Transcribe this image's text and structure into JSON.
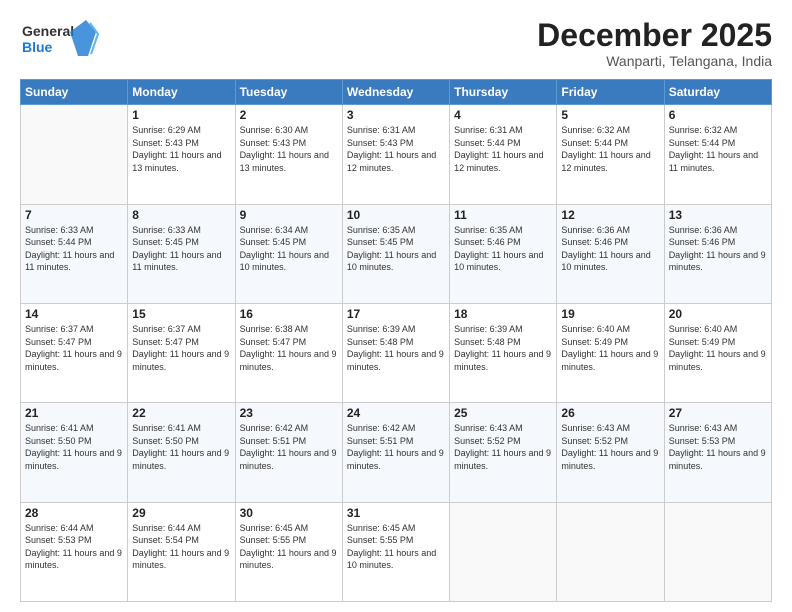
{
  "header": {
    "logo": {
      "general": "General",
      "blue": "Blue"
    },
    "title": "December 2025",
    "location": "Wanparti, Telangana, India"
  },
  "weekdays": [
    "Sunday",
    "Monday",
    "Tuesday",
    "Wednesday",
    "Thursday",
    "Friday",
    "Saturday"
  ],
  "weeks": [
    [
      {
        "day": null
      },
      {
        "day": 1,
        "sunrise": "6:29 AM",
        "sunset": "5:43 PM",
        "daylight": "11 hours and 13 minutes."
      },
      {
        "day": 2,
        "sunrise": "6:30 AM",
        "sunset": "5:43 PM",
        "daylight": "11 hours and 13 minutes."
      },
      {
        "day": 3,
        "sunrise": "6:31 AM",
        "sunset": "5:43 PM",
        "daylight": "11 hours and 12 minutes."
      },
      {
        "day": 4,
        "sunrise": "6:31 AM",
        "sunset": "5:44 PM",
        "daylight": "11 hours and 12 minutes."
      },
      {
        "day": 5,
        "sunrise": "6:32 AM",
        "sunset": "5:44 PM",
        "daylight": "11 hours and 12 minutes."
      },
      {
        "day": 6,
        "sunrise": "6:32 AM",
        "sunset": "5:44 PM",
        "daylight": "11 hours and 11 minutes."
      }
    ],
    [
      {
        "day": 7,
        "sunrise": "6:33 AM",
        "sunset": "5:44 PM",
        "daylight": "11 hours and 11 minutes."
      },
      {
        "day": 8,
        "sunrise": "6:33 AM",
        "sunset": "5:45 PM",
        "daylight": "11 hours and 11 minutes."
      },
      {
        "day": 9,
        "sunrise": "6:34 AM",
        "sunset": "5:45 PM",
        "daylight": "11 hours and 10 minutes."
      },
      {
        "day": 10,
        "sunrise": "6:35 AM",
        "sunset": "5:45 PM",
        "daylight": "11 hours and 10 minutes."
      },
      {
        "day": 11,
        "sunrise": "6:35 AM",
        "sunset": "5:46 PM",
        "daylight": "11 hours and 10 minutes."
      },
      {
        "day": 12,
        "sunrise": "6:36 AM",
        "sunset": "5:46 PM",
        "daylight": "11 hours and 10 minutes."
      },
      {
        "day": 13,
        "sunrise": "6:36 AM",
        "sunset": "5:46 PM",
        "daylight": "11 hours and 9 minutes."
      }
    ],
    [
      {
        "day": 14,
        "sunrise": "6:37 AM",
        "sunset": "5:47 PM",
        "daylight": "11 hours and 9 minutes."
      },
      {
        "day": 15,
        "sunrise": "6:37 AM",
        "sunset": "5:47 PM",
        "daylight": "11 hours and 9 minutes."
      },
      {
        "day": 16,
        "sunrise": "6:38 AM",
        "sunset": "5:47 PM",
        "daylight": "11 hours and 9 minutes."
      },
      {
        "day": 17,
        "sunrise": "6:39 AM",
        "sunset": "5:48 PM",
        "daylight": "11 hours and 9 minutes."
      },
      {
        "day": 18,
        "sunrise": "6:39 AM",
        "sunset": "5:48 PM",
        "daylight": "11 hours and 9 minutes."
      },
      {
        "day": 19,
        "sunrise": "6:40 AM",
        "sunset": "5:49 PM",
        "daylight": "11 hours and 9 minutes."
      },
      {
        "day": 20,
        "sunrise": "6:40 AM",
        "sunset": "5:49 PM",
        "daylight": "11 hours and 9 minutes."
      }
    ],
    [
      {
        "day": 21,
        "sunrise": "6:41 AM",
        "sunset": "5:50 PM",
        "daylight": "11 hours and 9 minutes."
      },
      {
        "day": 22,
        "sunrise": "6:41 AM",
        "sunset": "5:50 PM",
        "daylight": "11 hours and 9 minutes."
      },
      {
        "day": 23,
        "sunrise": "6:42 AM",
        "sunset": "5:51 PM",
        "daylight": "11 hours and 9 minutes."
      },
      {
        "day": 24,
        "sunrise": "6:42 AM",
        "sunset": "5:51 PM",
        "daylight": "11 hours and 9 minutes."
      },
      {
        "day": 25,
        "sunrise": "6:43 AM",
        "sunset": "5:52 PM",
        "daylight": "11 hours and 9 minutes."
      },
      {
        "day": 26,
        "sunrise": "6:43 AM",
        "sunset": "5:52 PM",
        "daylight": "11 hours and 9 minutes."
      },
      {
        "day": 27,
        "sunrise": "6:43 AM",
        "sunset": "5:53 PM",
        "daylight": "11 hours and 9 minutes."
      }
    ],
    [
      {
        "day": 28,
        "sunrise": "6:44 AM",
        "sunset": "5:53 PM",
        "daylight": "11 hours and 9 minutes."
      },
      {
        "day": 29,
        "sunrise": "6:44 AM",
        "sunset": "5:54 PM",
        "daylight": "11 hours and 9 minutes."
      },
      {
        "day": 30,
        "sunrise": "6:45 AM",
        "sunset": "5:55 PM",
        "daylight": "11 hours and 9 minutes."
      },
      {
        "day": 31,
        "sunrise": "6:45 AM",
        "sunset": "5:55 PM",
        "daylight": "11 hours and 10 minutes."
      },
      {
        "day": null
      },
      {
        "day": null
      },
      {
        "day": null
      }
    ]
  ]
}
